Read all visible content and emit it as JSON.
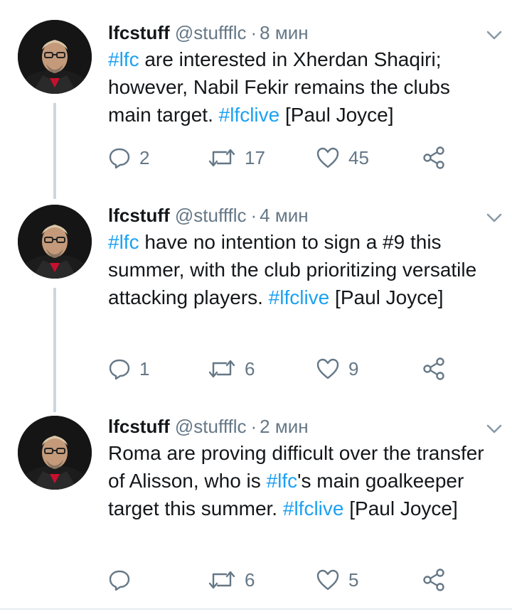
{
  "tweets": [
    {
      "name": "lfcstuff",
      "handle": "@stuffflc",
      "dot": "·",
      "time": "8 мин",
      "text": [
        {
          "t": "#lfc",
          "tag": true
        },
        {
          "t": " are interested in Xherdan Shaqiri; however, Nabil Fekir remains the clubs main target. ",
          "tag": false
        },
        {
          "t": "#lfclive",
          "tag": true
        },
        {
          "t": " [Paul Joyce]",
          "tag": false
        }
      ],
      "replies": "2",
      "retweets": "17",
      "likes": "45"
    },
    {
      "name": "lfcstuff",
      "handle": "@stuffflc",
      "dot": "·",
      "time": "4 мин",
      "text": [
        {
          "t": "#lfc",
          "tag": true
        },
        {
          "t": " have no intention to sign a #9 this summer, with the club prioritizing versatile attacking players. ",
          "tag": false
        },
        {
          "t": "#lfclive",
          "tag": true
        },
        {
          "t": " [Paul Joyce]",
          "tag": false
        }
      ],
      "replies": "1",
      "retweets": "6",
      "likes": "9"
    },
    {
      "name": "lfcstuff",
      "handle": "@stuffflc",
      "dot": "·",
      "time": "2 мин",
      "text": [
        {
          "t": "Roma are proving difficult over the transfer of Alisson, who is ",
          "tag": false
        },
        {
          "t": "#lfc",
          "tag": true
        },
        {
          "t": "'s main goalkeeper target this summer. ",
          "tag": false
        },
        {
          "t": "#lfclive",
          "tag": true
        },
        {
          "t": " [Paul Joyce]",
          "tag": false
        }
      ],
      "replies": "",
      "retweets": "6",
      "likes": "5"
    }
  ],
  "icons": {
    "reply": "reply-icon",
    "retweet": "retweet-icon",
    "like": "heart-icon",
    "share": "share-icon",
    "caret": "chevron-down-icon"
  },
  "colors": {
    "hashtag": "#1da1f2",
    "secondary": "#657786",
    "thread_line": "#ccd6dd",
    "text": "#14171a"
  }
}
